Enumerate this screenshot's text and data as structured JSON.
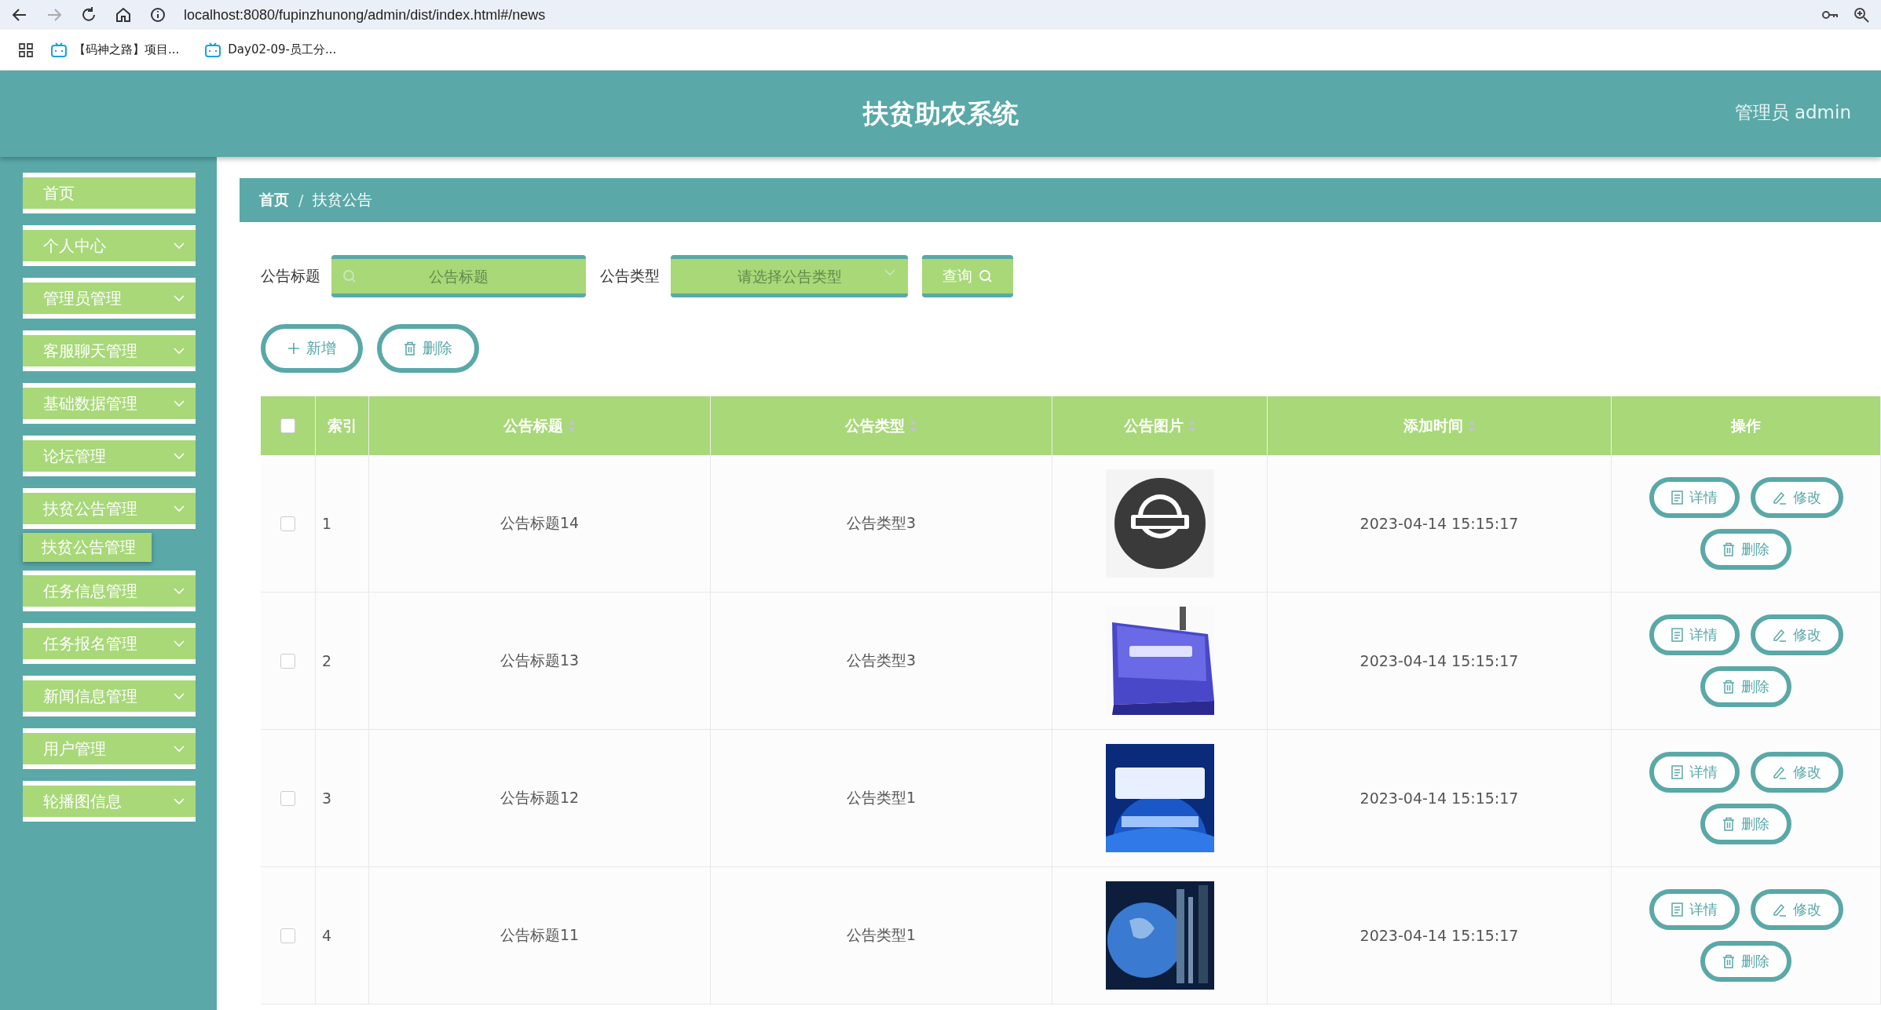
{
  "browser": {
    "url": "localhost:8080/fupinzhunong/admin/dist/index.html#/news",
    "bookmarks": [
      "【码神之路】项目...",
      "Day02-09-员工分..."
    ]
  },
  "header": {
    "title": "扶贫助农系统",
    "user": "管理员 admin"
  },
  "sidebar": {
    "items": [
      {
        "label": "首页",
        "kind": "link"
      },
      {
        "label": "个人中心",
        "kind": "menu"
      },
      {
        "label": "管理员管理",
        "kind": "menu"
      },
      {
        "label": "客服聊天管理",
        "kind": "menu"
      },
      {
        "label": "基础数据管理",
        "kind": "menu"
      },
      {
        "label": "论坛管理",
        "kind": "menu"
      },
      {
        "label": "扶贫公告管理",
        "kind": "menu",
        "children": [
          {
            "label": "扶贫公告管理",
            "selected": true
          }
        ]
      },
      {
        "label": "任务信息管理",
        "kind": "menu"
      },
      {
        "label": "任务报名管理",
        "kind": "menu"
      },
      {
        "label": "新闻信息管理",
        "kind": "menu"
      },
      {
        "label": "用户管理",
        "kind": "menu"
      },
      {
        "label": "轮播图信息",
        "kind": "menu"
      }
    ]
  },
  "breadcrumb": {
    "items": [
      "首页",
      "扶贫公告"
    ],
    "separator": "/"
  },
  "search": {
    "title_label": "公告标题",
    "title_placeholder": "公告标题",
    "type_label": "公告类型",
    "type_placeholder": "请选择公告类型",
    "query_button": "查询"
  },
  "actions": {
    "add": "新增",
    "delete": "删除"
  },
  "table": {
    "select_all_checked": false,
    "columns": [
      {
        "label": "索引",
        "sortable": false
      },
      {
        "label": "公告标题",
        "sortable": true
      },
      {
        "label": "公告类型",
        "sortable": true
      },
      {
        "label": "公告图片",
        "sortable": true
      },
      {
        "label": "添加时间",
        "sortable": true
      },
      {
        "label": "操作",
        "sortable": false
      }
    ],
    "rows": [
      {
        "checked": false,
        "index": "1",
        "title": "公告标题14",
        "type": "公告类型3",
        "time": "2023-04-14 15:15:17",
        "buttons": {
          "detail": "详情",
          "edit": "修改",
          "delete": "删除"
        }
      },
      {
        "checked": false,
        "index": "2",
        "title": "公告标题13",
        "type": "公告类型3",
        "time": "2023-04-14 15:15:17",
        "buttons": {
          "detail": "详情",
          "edit": "修改",
          "delete": "删除"
        }
      },
      {
        "checked": false,
        "index": "3",
        "title": "公告标题12",
        "type": "公告类型1",
        "time": "2023-04-14 15:15:17",
        "buttons": {
          "detail": "详情",
          "edit": "修改",
          "delete": "删除"
        }
      },
      {
        "checked": false,
        "index": "4",
        "title": "公告标题11",
        "type": "公告类型1",
        "time": "2023-04-14 15:15:17",
        "buttons": {
          "detail": "详情",
          "edit": "修改",
          "delete": "删除"
        }
      }
    ]
  }
}
